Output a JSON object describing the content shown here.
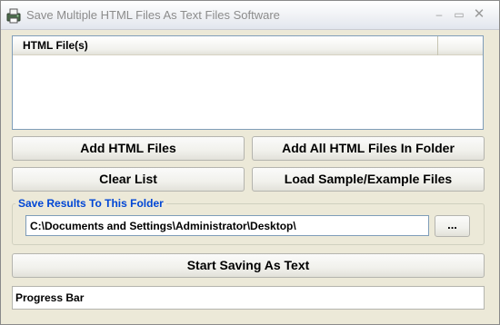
{
  "window": {
    "title": "Save Multiple HTML Files As Text Files Software",
    "minimize_glyph": "–",
    "maximize_glyph": "▭",
    "close_glyph": "✕"
  },
  "file_list": {
    "column_header": "HTML File(s)",
    "rows": []
  },
  "buttons": {
    "add_html_files": "Add HTML Files",
    "add_all_in_folder": "Add All HTML Files In Folder",
    "clear_list": "Clear List",
    "load_sample": "Load Sample/Example Files",
    "browse": "...",
    "start_saving": "Start Saving As Text"
  },
  "save_results": {
    "legend": "Save Results To This Folder",
    "folder_path": "C:\\Documents and Settings\\Administrator\\Desktop\\"
  },
  "progress": {
    "label": "Progress Bar"
  },
  "icons": {
    "app_icon": "printer-document-icon"
  }
}
